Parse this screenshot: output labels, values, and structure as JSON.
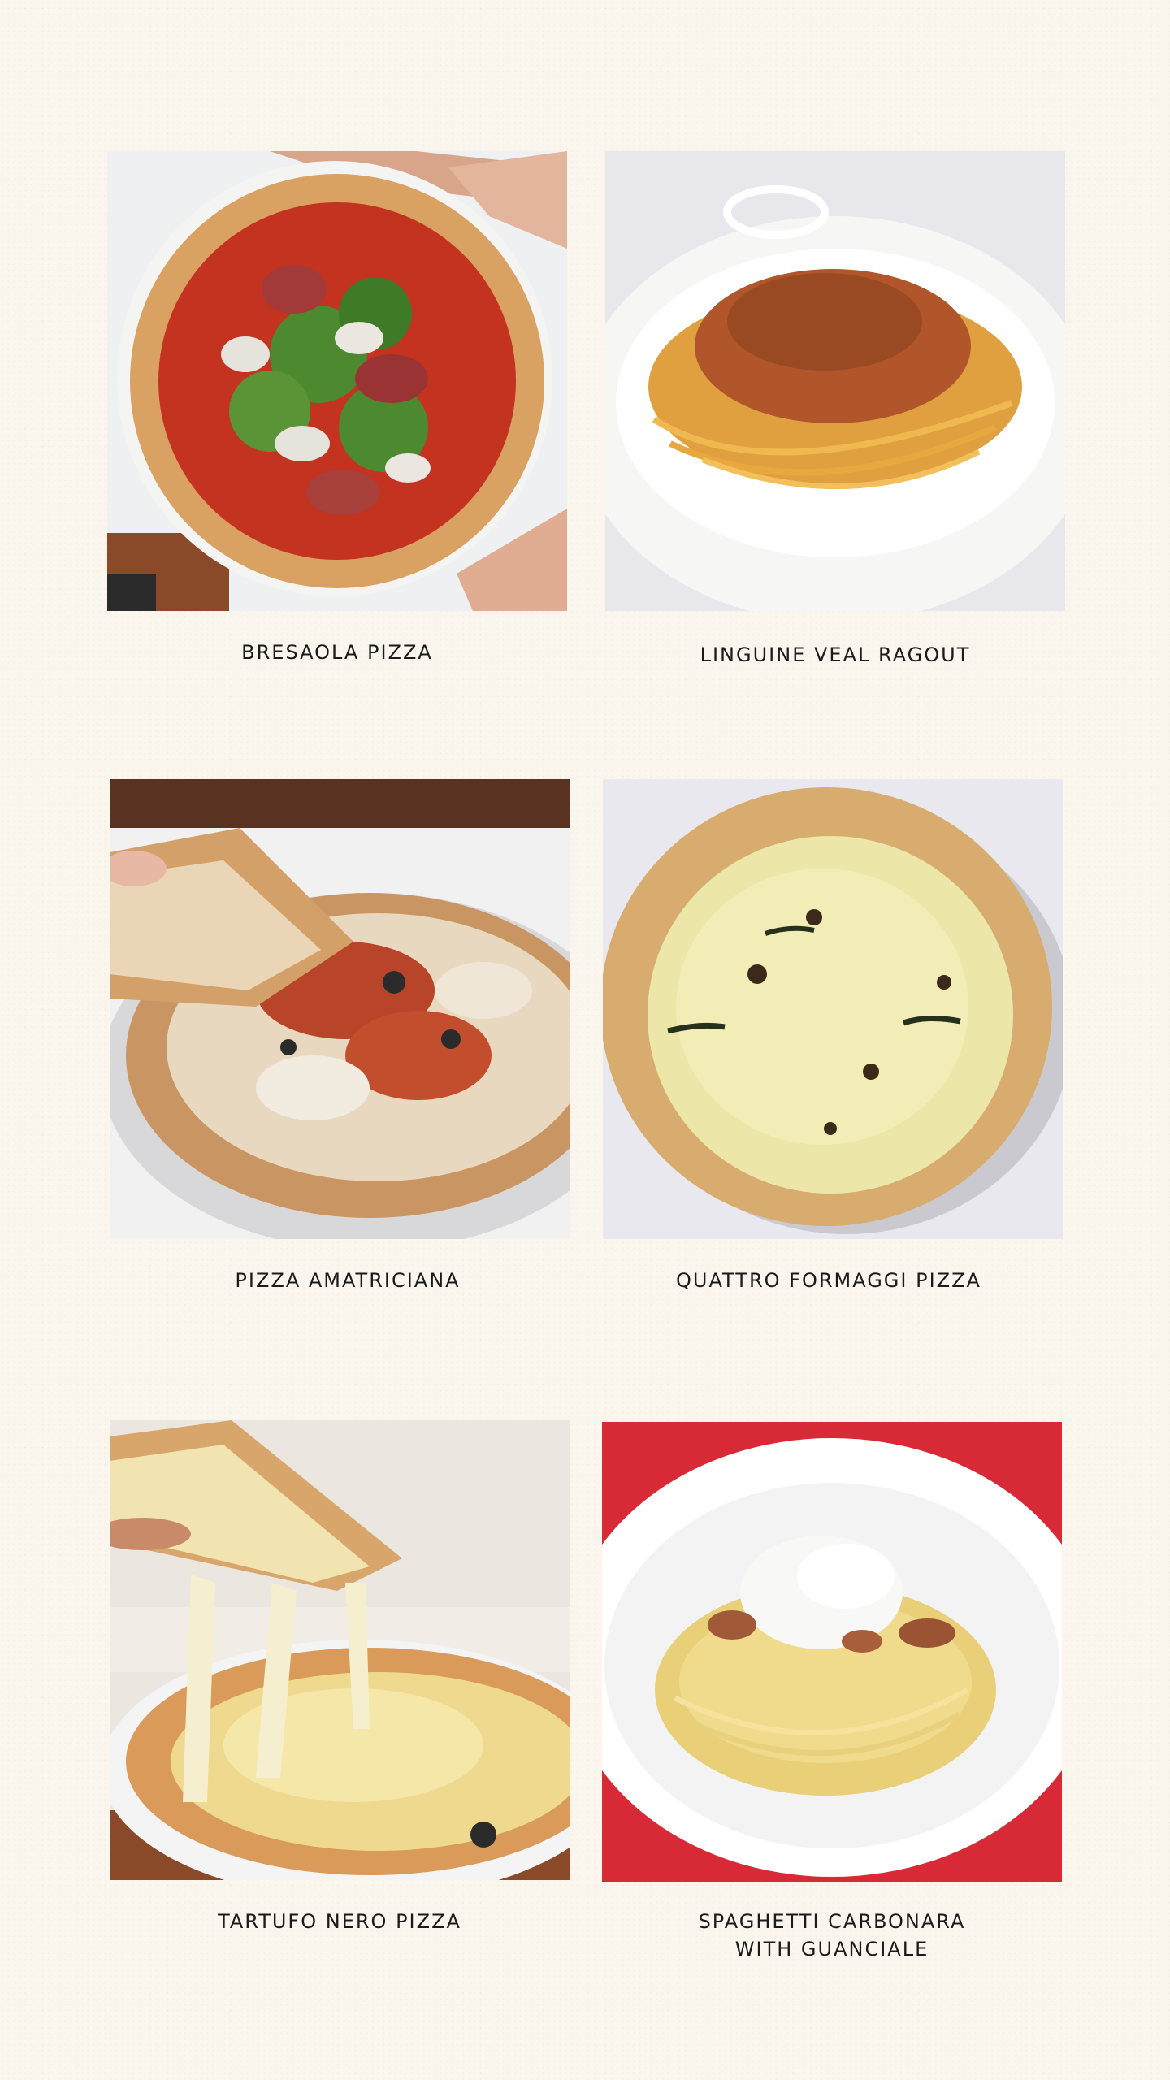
{
  "menu": {
    "items": [
      {
        "name": "BRESAOLA PIZZA",
        "photo": "bresaola-pizza-photo"
      },
      {
        "name": "LINGUINE VEAL RAGOUT",
        "photo": "linguine-veal-ragout-photo"
      },
      {
        "name": "PIZZA AMATRICIANA",
        "photo": "pizza-amatriciana-photo"
      },
      {
        "name": "QUATTRO FORMAGGI PIZZA",
        "photo": "quattro-formaggi-pizza-photo"
      },
      {
        "name": "TARTUFO NERO PIZZA",
        "photo": "tartufo-nero-pizza-photo"
      },
      {
        "name": "SPAGHETTI CARBONARA\nWITH GUANCIALE",
        "photo": "spaghetti-carbonara-photo"
      }
    ]
  },
  "colors": {
    "background": "#faf6ee",
    "text": "#1b1b1b"
  }
}
